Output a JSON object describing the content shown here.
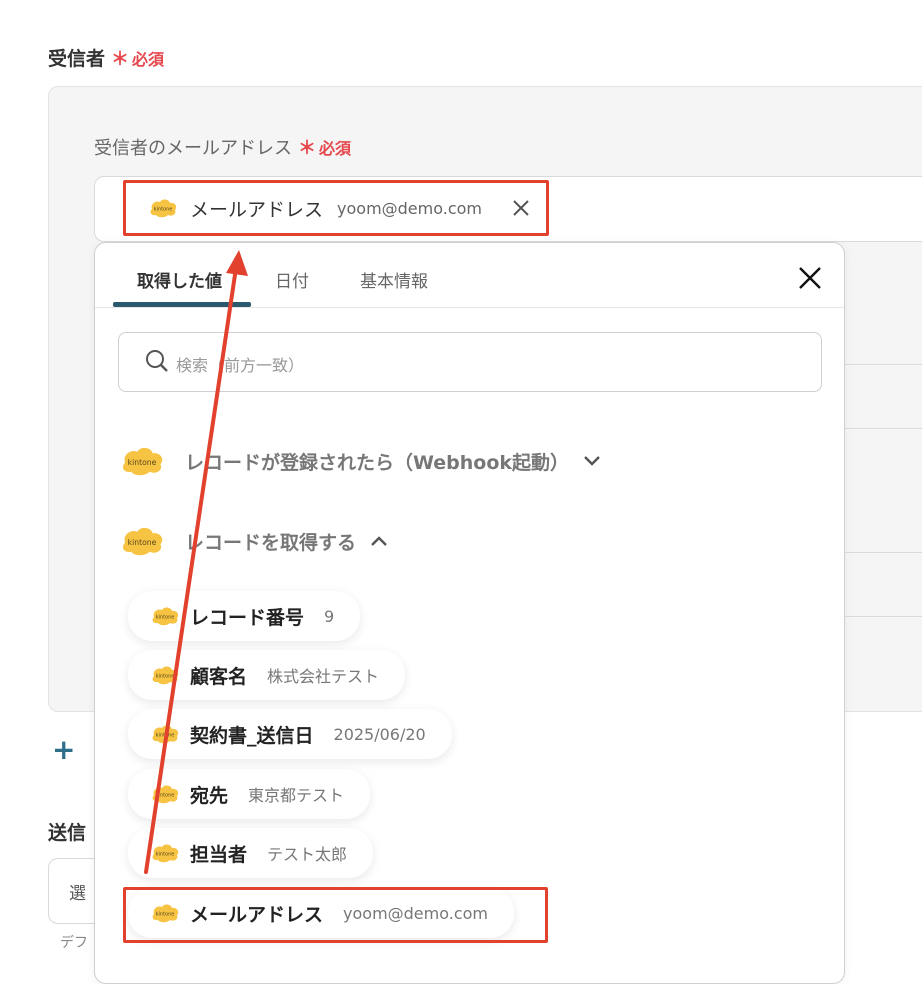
{
  "recipient": {
    "label": "受信者",
    "required_mark": "＊",
    "required_text": "必須",
    "email_field": {
      "label": "受信者のメールアドレス",
      "required_mark": "＊",
      "required_text": "必須",
      "chip": {
        "name": "メールアドレス",
        "value": "yoom@demo.com",
        "icon": "kintone-logo"
      }
    }
  },
  "popup": {
    "tabs": [
      {
        "label": "取得した値",
        "active": true
      },
      {
        "label": "日付",
        "active": false
      },
      {
        "label": "基本情報",
        "active": false
      }
    ],
    "search_placeholder": "検索（前方一致）",
    "groups": [
      {
        "title": "レコードが登録されたら（Webhook起動）",
        "expanded": false,
        "icon": "kintone-logo"
      },
      {
        "title": "レコードを取得する",
        "expanded": true,
        "icon": "kintone-logo"
      }
    ],
    "items": [
      {
        "name": "レコード番号",
        "value": "9"
      },
      {
        "name": "顧客名",
        "value": "株式会社テスト"
      },
      {
        "name": "契約書_送信日",
        "value": "2025/06/20"
      },
      {
        "name": "宛先",
        "value": "東京都テスト"
      },
      {
        "name": "担当者",
        "value": "テスト太郎"
      },
      {
        "name": "メールアドレス",
        "value": "yoom@demo.com"
      }
    ]
  },
  "add_button": "+",
  "bottom": {
    "label": "送信",
    "select_value": "選",
    "help_text": "デフ"
  },
  "colors": {
    "required": "#e5484d",
    "highlight": "#e2412e",
    "tab_underline": "#2b5a6e",
    "kintone": "#f6c343"
  }
}
